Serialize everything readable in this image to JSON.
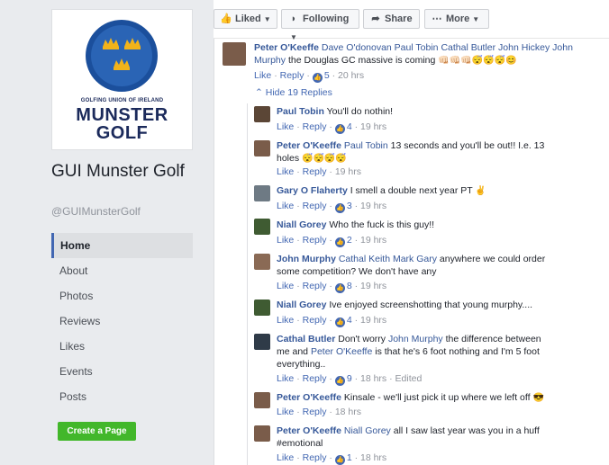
{
  "page": {
    "name": "GUI Munster Golf",
    "handle": "@GUIMunsterGolf",
    "logo": {
      "small_text": "GOLFING UNION OF IRELAND",
      "line1": "MUNSTER",
      "line2": "GOLF",
      "ring_color": "#1b4f9c",
      "crown_color": "#f2b31a"
    }
  },
  "nav": {
    "items": [
      "Home",
      "About",
      "Photos",
      "Reviews",
      "Likes",
      "Events",
      "Posts"
    ],
    "active": "Home"
  },
  "create_page_label": "Create a Page",
  "action_bar": {
    "liked": "Liked",
    "following": "Following",
    "share": "Share",
    "more": "More"
  },
  "top_comment": {
    "author": "Peter O'Keeffe",
    "tags": "Dave O'donovan Paul Tobin Cathal Butler John Hickey John Murphy",
    "text": "the Douglas GC massive is coming",
    "emojis": "👊🏻👊🏻👊🏻😴😴😴😊",
    "like": "Like",
    "reply": "Reply",
    "likes": "5",
    "time": "20 hrs"
  },
  "hide_replies": "Hide 19 Replies",
  "replies": [
    {
      "author": "Paul Tobin",
      "tags": "",
      "text": "You'll do nothin!",
      "likes": "4",
      "time": "19 hrs",
      "edited": ""
    },
    {
      "author": "Peter O'Keeffe",
      "tags": "Paul Tobin",
      "text": "13 seconds and you'll be out!! I.e. 13 holes",
      "emojis": "😴😴😴😴",
      "likes": "",
      "time": "19 hrs",
      "edited": ""
    },
    {
      "author": "Gary O Flaherty",
      "tags": "",
      "text": "I smell a double next year PT",
      "emojis": "✌",
      "likes": "3",
      "time": "19 hrs",
      "edited": ""
    },
    {
      "author": "Niall Gorey",
      "tags": "",
      "text": "Who the fuck is this guy!!",
      "likes": "2",
      "time": "19 hrs",
      "edited": ""
    },
    {
      "author": "John Murphy",
      "tags": "Cathal Keith Mark Gary",
      "text": "anywhere we could order some competition? We don't have any",
      "likes": "8",
      "time": "19 hrs",
      "edited": ""
    },
    {
      "author": "Niall Gorey",
      "tags": "",
      "text": "Ive enjoyed screenshotting that young murphy....",
      "likes": "4",
      "time": "19 hrs",
      "edited": ""
    },
    {
      "author": "Cathal Butler",
      "tags": "",
      "text_parts": [
        "Don't worry",
        "John Murphy",
        "the difference between me and",
        "Peter O'Keeffe",
        "is that he's 6 foot nothing and I'm 5 foot everything.."
      ],
      "likes": "9",
      "time": "18 hrs",
      "edited": "Edited"
    },
    {
      "author": "Peter O'Keeffe",
      "tags": "",
      "text": "Kinsale - we'll just pick it up where we left off",
      "emojis": "😎",
      "likes": "",
      "time": "18 hrs",
      "edited": ""
    },
    {
      "author": "Peter O'Keeffe",
      "tags": "Niall Gorey",
      "text": "all I saw last year was you in a huff #emotional",
      "likes": "1",
      "time": "18 hrs",
      "edited": ""
    }
  ],
  "labels": {
    "like": "Like",
    "reply": "Reply",
    "dot": "·"
  }
}
